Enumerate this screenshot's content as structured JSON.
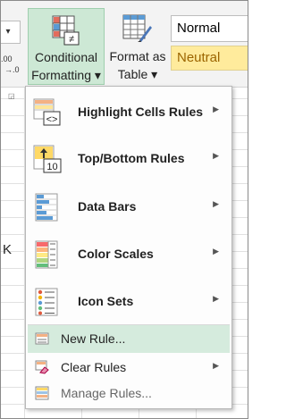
{
  "ribbon": {
    "left_box_text": "▾",
    "left_dec_text": ".00",
    "left_dec_text2": "→.0",
    "launcher_icon": "dialog-launcher-icon",
    "conditional_formatting": {
      "line1": "Conditional",
      "line2": "Formatting ▾"
    },
    "format_as_table": {
      "line1": "Format as",
      "line2": "Table ▾"
    },
    "styles": {
      "normal": "Normal",
      "neutral": "Neutral"
    }
  },
  "sheet": {
    "cell_text": "K"
  },
  "menu": {
    "items": [
      {
        "label": "Highlight Cells Rules",
        "icon": "highlight-cells-rules-icon"
      },
      {
        "label": "Top/Bottom Rules",
        "icon": "top-bottom-rules-icon"
      },
      {
        "label": "Data Bars",
        "icon": "data-bars-icon"
      },
      {
        "label": "Color Scales",
        "icon": "color-scales-icon"
      },
      {
        "label": "Icon Sets",
        "icon": "icon-sets-icon"
      }
    ],
    "small_items": [
      {
        "label": "New Rule...",
        "icon": "new-rule-icon"
      },
      {
        "label": "Clear Rules",
        "icon": "clear-rules-icon"
      },
      {
        "label": "Manage Rules...",
        "icon": "manage-rules-icon"
      }
    ],
    "submenu_arrow": "▶"
  },
  "colors": {
    "ribbon_selected": "#cde8d5",
    "menu_hover": "#d5ebdd",
    "neutral_fill": "#ffeb9c",
    "neutral_text": "#9c6500"
  }
}
